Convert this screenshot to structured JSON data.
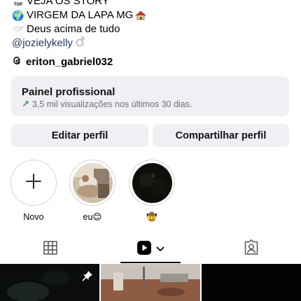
{
  "bio": {
    "line1": {
      "badge": "TOP",
      "text": "VEJA OS STORY"
    },
    "line2": {
      "text": "VIRGEM DA LAPA MG"
    },
    "line3": {
      "text": "Deus  acima de tudo"
    },
    "line4": {
      "text": "@jozielykelly"
    }
  },
  "threads": {
    "username": "eriton_gabriel032"
  },
  "panel": {
    "title": "Painel profissional",
    "subtitle": "3,5 mil visualizações nos últimos 30 dias."
  },
  "buttons": {
    "edit": "Editar perfil",
    "share": "Compartilhar perfil"
  },
  "highlights": [
    {
      "label": "Novo"
    },
    {
      "label": "eu😊"
    },
    {
      "label": "🤠"
    }
  ],
  "colors": {
    "panel_bg": "#efeff4",
    "link": "#24386b",
    "growth_arrow": "#2f9e44",
    "secondary_text": "#6f6f73"
  },
  "tabs": [
    {
      "icon": "grid-icon",
      "active": false
    },
    {
      "icon": "reels-icon",
      "active": true
    },
    {
      "icon": "tagged-icon",
      "active": false
    }
  ]
}
